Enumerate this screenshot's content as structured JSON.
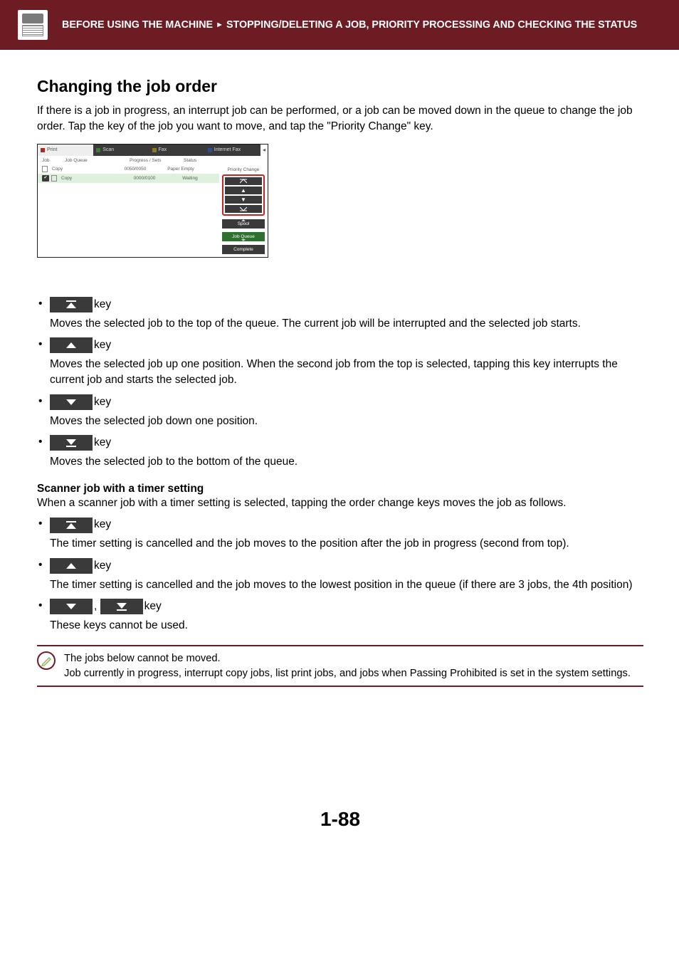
{
  "header": {
    "section": "BEFORE USING THE MACHINE",
    "subsection": "STOPPING/DELETING A JOB, PRIORITY PROCESSING AND CHECKING THE STATUS"
  },
  "page": {
    "heading": "Changing the job order",
    "intro": "If there is a job in progress, an interrupt job can be performed, or a job can be moved down in the queue to change the job order. Tap the key of the job you want to move, and tap the \"Priority Change\" key.",
    "page_number": "1-88"
  },
  "shot": {
    "tabs": {
      "print": "Print",
      "scan": "Scan",
      "fax": "Fax",
      "ifax": "Internet Fax"
    },
    "cols": {
      "job": "Job",
      "jobqueue": "Job Queue",
      "progress": "Progress / Sets",
      "status": "Status"
    },
    "rows": [
      {
        "name": "Copy",
        "progress": "0050/0050",
        "status": "Paper Empty"
      },
      {
        "name": "Copy",
        "progress": "0000/0100",
        "status": "Waiting"
      }
    ],
    "side": {
      "priority": "Priority Change",
      "spool": "Spool",
      "jobqueue": "Job Queue",
      "complete": "Complete"
    }
  },
  "keys_primary": [
    {
      "icon": "top",
      "label": "key",
      "desc": "Moves the selected job to the top of the queue. The current job will be interrupted and the selected job starts."
    },
    {
      "icon": "up",
      "label": "key",
      "desc": "Moves the selected job up one position. When the second job from the top is selected, tapping this key interrupts the current job and starts the selected job."
    },
    {
      "icon": "down",
      "label": "key",
      "desc": "Moves the selected job down one position."
    },
    {
      "icon": "bottom",
      "label": "key",
      "desc": "Moves the selected job to the bottom of the queue."
    }
  ],
  "scanner": {
    "heading": "Scanner job with a timer setting",
    "intro": "When a scanner job with a timer setting is selected, tapping the order change keys moves the job as follows."
  },
  "keys_scanner": [
    {
      "icon": "top",
      "label": "key",
      "desc": "The timer setting is cancelled and the job moves to the position after the job in progress (second from top)."
    },
    {
      "icon": "up",
      "label": "key",
      "desc": "The timer setting is cancelled and the job moves to the lowest position in the queue (if there are 3 jobs, the 4th position)"
    },
    {
      "icon": "down_bottom",
      "label": "key",
      "comma": ", ",
      "desc": "These keys cannot be used."
    }
  ],
  "note": {
    "line1": "The jobs below cannot be moved.",
    "line2": "Job currently in progress, interrupt copy jobs, list print jobs, and jobs when Passing Prohibited is set in the system settings."
  }
}
